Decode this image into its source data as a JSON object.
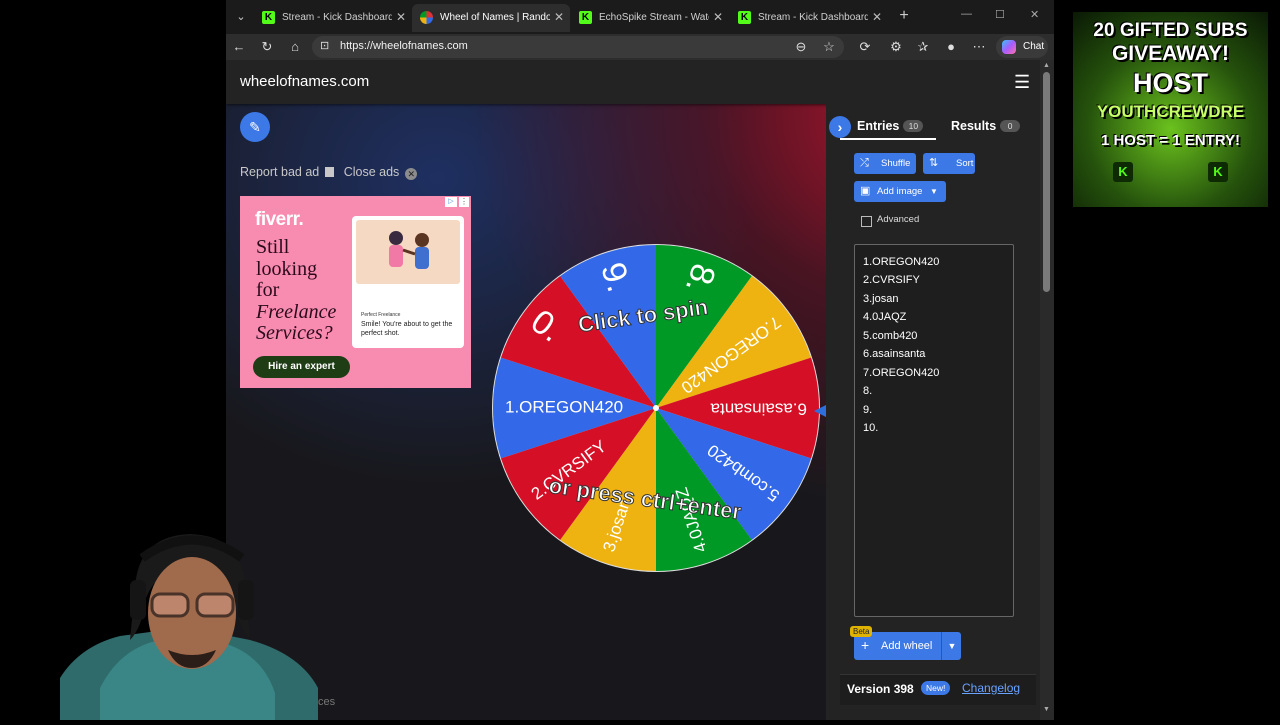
{
  "browser": {
    "tabs": [
      {
        "title": "Stream - Kick Dashboard",
        "favicon": "kick-icon",
        "active": false
      },
      {
        "title": "Wheel of Names | Random",
        "favicon": "wheel-of-names-icon",
        "active": true
      },
      {
        "title": "EchoSpike Stream - Watch",
        "favicon": "kick-icon",
        "active": false
      },
      {
        "title": "Stream - Kick Dashboard",
        "favicon": "kick-icon",
        "active": false
      }
    ],
    "url": "https://wheelofnames.com",
    "copilot_label": "Chat"
  },
  "site": {
    "title": "wheelofnames.com",
    "report_bad_ad": "Report bad ad",
    "close_ads": "Close ads"
  },
  "ad": {
    "logo": "fiverr.",
    "headline": [
      "Still",
      "looking",
      "for"
    ],
    "headline_italic": [
      "Freelance",
      "Services?"
    ],
    "card_title": "Perfect Freelance",
    "card_text": "Smile! You're about to get the perfect shot.",
    "cta": "Hire an expert"
  },
  "wheel": {
    "overlay_top": "Click to spin",
    "overlay_bottom": "or press ctrl+enter",
    "segments": [
      {
        "label": "1.OREGON420",
        "color": "#3369e8"
      },
      {
        "label": "0.",
        "color": "#d50f25"
      },
      {
        "label": "9.",
        "color": "#3369e8"
      },
      {
        "label": "8.",
        "color": "#009925"
      },
      {
        "label": "7.OREGON420",
        "color": "#eeb211"
      },
      {
        "label": "6.asainsanta",
        "color": "#d50f25"
      },
      {
        "label": "5.comb420",
        "color": "#3369e8"
      },
      {
        "label": "4.0JAQZ",
        "color": "#009925"
      },
      {
        "label": "3.josan",
        "color": "#eeb211"
      },
      {
        "label": "2.CVRSIFY",
        "color": "#d50f25"
      }
    ]
  },
  "panel": {
    "tab_entries": "Entries",
    "entries_count": "10",
    "tab_results": "Results",
    "results_count": "0",
    "shuffle": "Shuffle",
    "sort": "Sort",
    "add_image": "Add image",
    "advanced": "Advanced",
    "entries": [
      "1.OREGON420",
      "2.CVRSIFY",
      "3.josan",
      "4.0JAQZ",
      "5.comb420",
      "6.asainsanta",
      "7.OREGON420",
      "8.",
      "9.",
      "10."
    ],
    "beta": "Beta",
    "add_wheel": "Add wheel",
    "version": "Version 398",
    "new_badge": "New!",
    "changelog": "Changelog",
    "bottom_partial": "ces"
  },
  "promo": {
    "line1": "20 GIFTED SUBS",
    "line2": "GIVEAWAY!",
    "line3": "HOST",
    "line4": "YOUTHCREWDRE",
    "line5": "1 HOST = 1 ENTRY!",
    "k1": "K",
    "k2": "K"
  }
}
